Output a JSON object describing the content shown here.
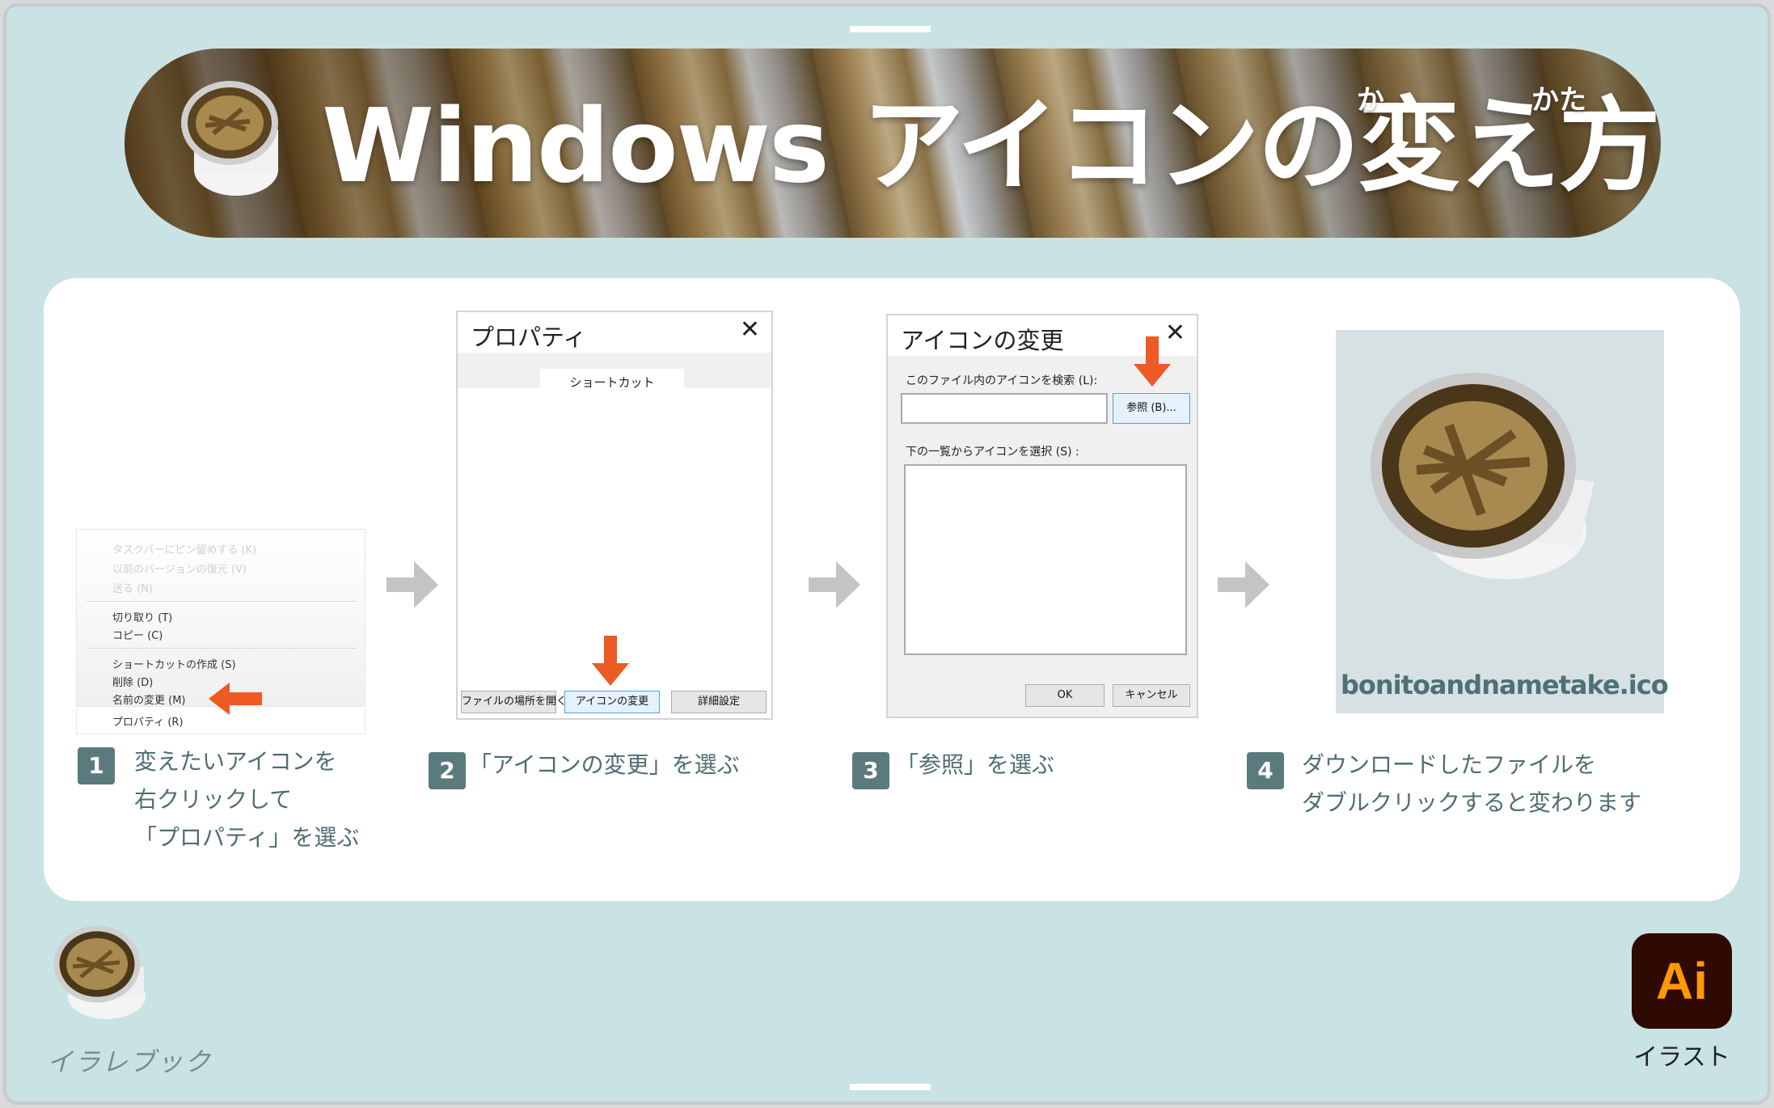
{
  "banner": {
    "title": "Windows アイコンの変え方",
    "ruby_ka": "か",
    "ruby_kata": "かた"
  },
  "step1": {
    "menu_items_faded": [
      "タスクバーにピン留めする (K)",
      "以前のバージョンの復元 (V)",
      "送る (N)"
    ],
    "menu_items": [
      "切り取り (T)",
      "コピー (C)",
      "ショートカットの作成 (S)",
      "削除 (D)",
      "名前の変更 (M)",
      "プロパティ (R)"
    ],
    "number": "1",
    "caption_lines": [
      "変えたいアイコンを",
      "右クリックして",
      "「プロパティ」を選ぶ"
    ]
  },
  "step2": {
    "dialog_title": "プロパティ",
    "close_glyph": "✕",
    "tab": "ショートカット",
    "buttons": [
      "ファイルの場所を開く",
      "アイコンの変更",
      "詳細設定"
    ],
    "number": "2",
    "caption": "「アイコンの変更」を選ぶ"
  },
  "step3": {
    "dialog_title": "アイコンの変更",
    "close_glyph": "✕",
    "search_label": "このファイル内のアイコンを検索 (L):",
    "browse_button": "参照 (B)...",
    "list_label": "下の一覧からアイコンを選択 (S) :",
    "ok_button": "OK",
    "cancel_button": "キャンセル",
    "number": "3",
    "caption": "「参照」を選ぶ"
  },
  "step4": {
    "file_name": "bonitoandnametake.ico",
    "number": "4",
    "caption_lines": [
      "ダウンロードしたファイルを",
      "ダブルクリックすると変わります"
    ]
  },
  "footer": {
    "brand": "イラレブック",
    "ai_logo": "Ai",
    "ai_caption": "イラスト"
  },
  "colors": {
    "accent_arrow": "#ee5a24",
    "step_badge": "#5b7a7d",
    "caption_text": "#4e6e72",
    "background": "#c9e3e4"
  }
}
